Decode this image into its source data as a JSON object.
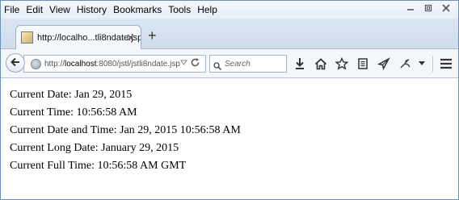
{
  "menu": {
    "file": "File",
    "edit": "Edit",
    "view": "View",
    "history": "History",
    "bookmarks": "Bookmarks",
    "tools": "Tools",
    "help": "Help"
  },
  "tab": {
    "title": "http://localho...tli8ndate.jsp",
    "new_tab": "+"
  },
  "nav": {
    "url_prefix": "http://",
    "url_host": "localhost",
    "url_rest": ":8080/jstl/jstli8ndate.jsp",
    "search_placeholder": "Search"
  },
  "content": {
    "lines": [
      "Current Date: Jan 29, 2015",
      "Current Time: 10:56:58 AM",
      "Current Date and Time: Jan 29, 2015 10:56:58 AM",
      "Current Long Date: January 29, 2015",
      "Current Full Time: 10:56:58 AM GMT"
    ]
  },
  "icons": {
    "back": "arrow-left-icon",
    "site": "globe-icon",
    "reload": "reload-icon",
    "search": "search-icon",
    "download": "download-icon",
    "home": "home-icon",
    "bookmark": "star-icon",
    "reading_list": "reading-list-icon",
    "share": "paper-plane-icon",
    "extension": "puzzle-icon",
    "menu": "hamburger-menu-icon"
  }
}
